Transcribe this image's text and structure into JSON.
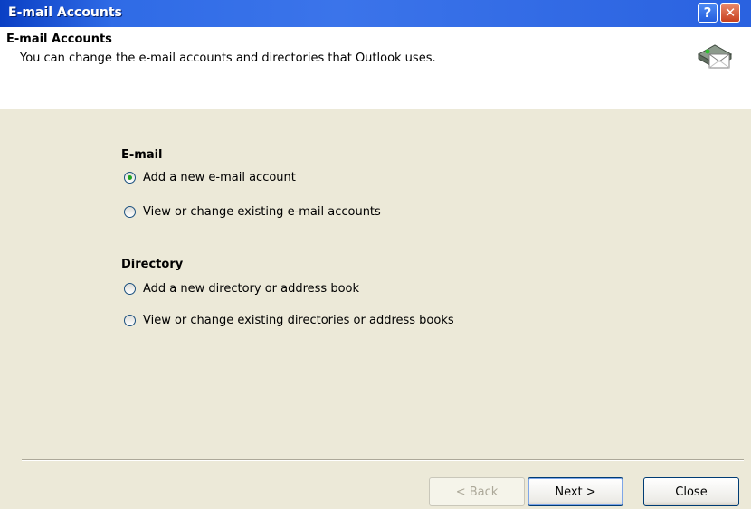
{
  "window": {
    "title": "E-mail Accounts",
    "help_glyph": "?",
    "close_glyph": "✕"
  },
  "header": {
    "title": "E-mail Accounts",
    "subtitle": "You can change the e-mail accounts and directories that Outlook uses.",
    "icon": "email-accounts-icon"
  },
  "email_group": {
    "label": "E-mail",
    "options": [
      {
        "label": "Add a new e-mail account",
        "selected": true
      },
      {
        "label": "View or change existing e-mail accounts",
        "selected": false
      }
    ]
  },
  "directory_group": {
    "label": "Directory",
    "options": [
      {
        "label": "Add a new directory or address book",
        "selected": false
      },
      {
        "label": "View or change existing directories or address books",
        "selected": false
      }
    ]
  },
  "buttons": {
    "back": "< Back",
    "next": "Next >",
    "close": "Close"
  }
}
